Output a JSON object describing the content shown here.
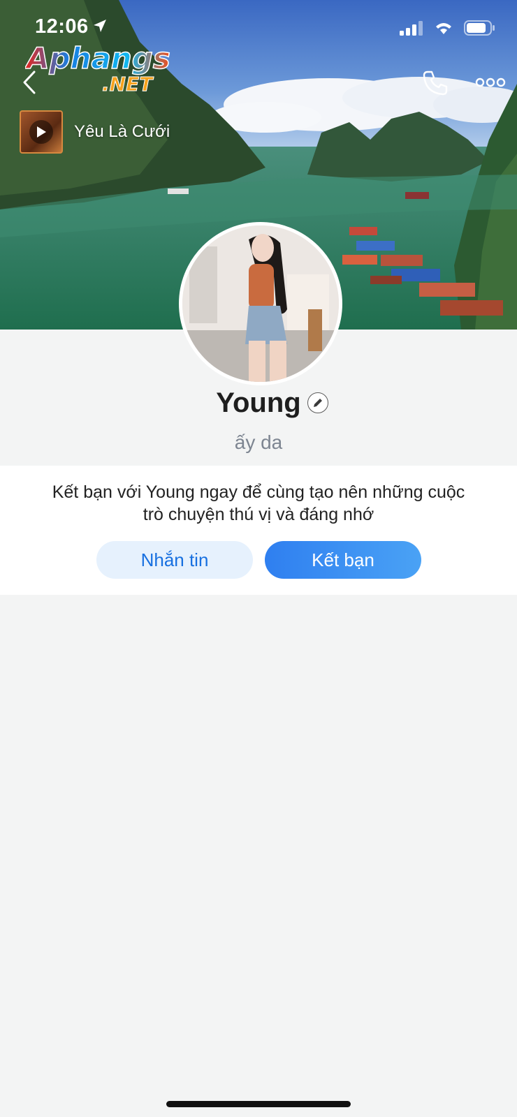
{
  "status_bar": {
    "time": "12:06",
    "icons": [
      "location-arrow-icon",
      "cellular-signal-icon",
      "wifi-icon",
      "battery-icon"
    ]
  },
  "watermark": {
    "brand": "Aphangs",
    "suffix": ".NET"
  },
  "cover": {
    "description_icon": "landscape-cover-photo",
    "music": {
      "title": "Yêu Là Cưới",
      "icon": "play-icon"
    }
  },
  "nav": {
    "back_icon": "chevron-left-icon",
    "call_icon": "phone-icon",
    "more_icon": "more-dots-icon"
  },
  "profile": {
    "name": "Young",
    "status": "ấy da",
    "edit_icon": "pencil-icon"
  },
  "invite": {
    "text_line1": "Kết bạn với Young ngay để cùng tạo nên những cuộc",
    "text_line2": "trò chuyện thú vị và đáng nhớ",
    "message_button": "Nhắn tin",
    "add_friend_button": "Kết bạn"
  },
  "colors": {
    "accent": "#2f7ff0",
    "message_button_bg": "#e6f1fd",
    "message_button_text": "#1870e0",
    "page_bg": "#f3f4f4"
  }
}
